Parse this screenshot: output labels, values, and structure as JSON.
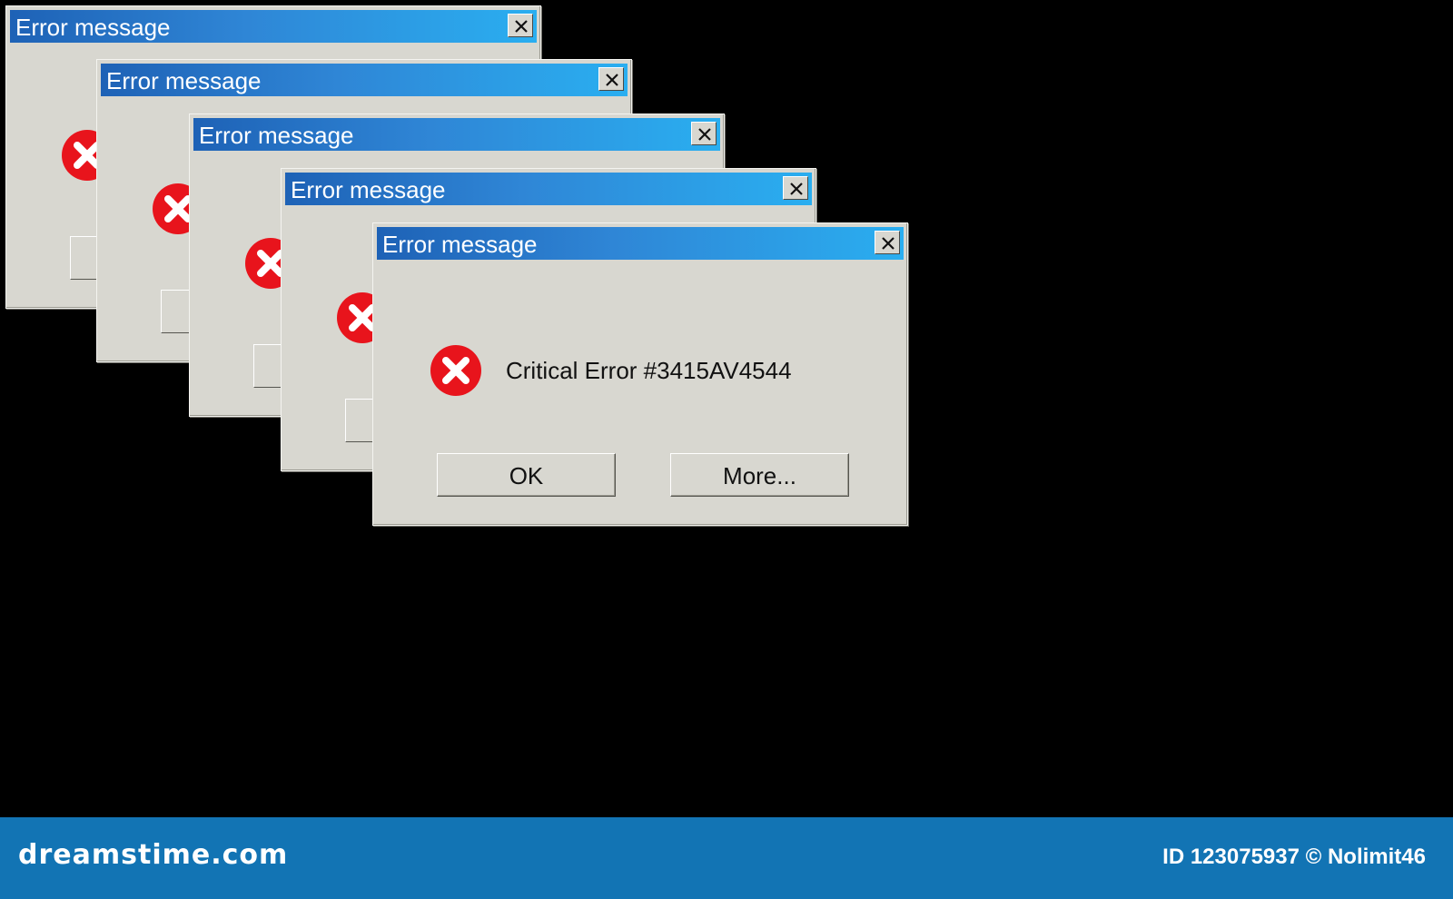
{
  "colors": {
    "background": "#000000",
    "dialog_face": "#d8d7d0",
    "titlebar_start": "#1e62b6",
    "titlebar_end": "#2aaef0",
    "error_red": "#e8141c",
    "footer": "#1274b4"
  },
  "dialogs": [
    {
      "title": "Error message",
      "close_icon": "close-icon",
      "icon": "error-icon"
    },
    {
      "title": "Error message",
      "close_icon": "close-icon",
      "icon": "error-icon"
    },
    {
      "title": "Error message",
      "close_icon": "close-icon",
      "icon": "error-icon"
    },
    {
      "title": "Error message",
      "close_icon": "close-icon",
      "icon": "error-icon"
    },
    {
      "title": "Error message",
      "close_icon": "close-icon",
      "icon": "error-icon",
      "message": "Critical Error #3415AV4544",
      "ok_label": "OK",
      "more_label": "More..."
    }
  ],
  "watermark": {
    "brand": "dreamstime.com",
    "image_id": "ID 123075937 © Nolimit46"
  }
}
